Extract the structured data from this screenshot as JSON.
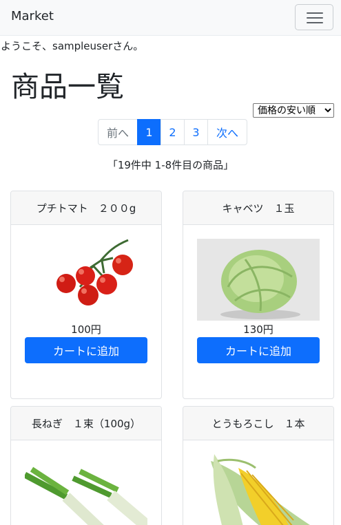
{
  "navbar": {
    "brand": "Market",
    "toggler": "menu-icon"
  },
  "welcome": "ようこそ、sampleuserさん。",
  "page_title": "商品一覧",
  "sort": {
    "selected": "価格の安い順"
  },
  "pagination": {
    "prev": "前へ",
    "pages": [
      "1",
      "2",
      "3"
    ],
    "current": "1",
    "next": "次へ"
  },
  "result_count": "「19件中 1-8件目の商品」",
  "products": [
    {
      "name": "プチトマト　２００g",
      "price": "100円",
      "button": "カートに追加",
      "image": "cherry-tomato-image"
    },
    {
      "name": "キャベツ　１玉",
      "price": "130円",
      "button": "カートに追加",
      "image": "cabbage-image"
    },
    {
      "name": "長ねぎ　１束（100g）",
      "image": "green-onion-image"
    },
    {
      "name": "とうもろこし　１本",
      "image": "corn-image"
    }
  ],
  "colors": {
    "primary": "#0d6efd",
    "navbar_bg": "#f8f9fa",
    "card_header_bg": "#f7f7f7"
  }
}
